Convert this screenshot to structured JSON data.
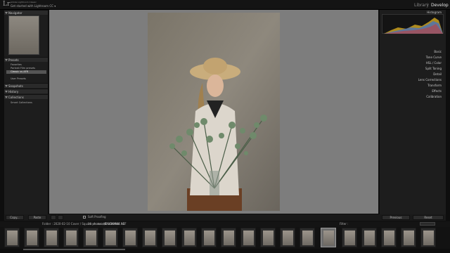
{
  "app": {
    "logo": "Lr",
    "catalog_line1": "Adobe Lightroom Classic",
    "catalog_line2": "Get started with Lightroom CC ▾"
  },
  "modules": {
    "library": "Library",
    "separator": "|",
    "develop": "Develop"
  },
  "left_panel": {
    "navigator": "Navigator",
    "presets": "Presets",
    "preset_items": [
      "Favorites",
      "Portrait Film presets",
      "Classic vs AFR",
      "User Presets"
    ],
    "snapshots": "Snapshots",
    "history": "History",
    "collections": "Collections",
    "collection_items": [
      "Smart Collections"
    ]
  },
  "right_panel": {
    "histogram": "Histogram",
    "sections": [
      "Basic",
      "Tone Curve",
      "HSL / Color",
      "Split Toning",
      "Detail",
      "Lens Corrections",
      "Transform",
      "Effects",
      "Calibration"
    ]
  },
  "toolbar": {
    "copy": "Copy...",
    "paste": "Paste",
    "soft_proofing": "Soft Proofing",
    "previous": "Previous",
    "reset": "Reset"
  },
  "filmstrip": {
    "source": "Folder : 2020-02-10 Cover / Square showcase",
    "count": "16 photos / 1 selected",
    "filename": "/DSC09984.NEF",
    "filter": "Filter :"
  },
  "colors": {
    "selected": "#9a9a9a",
    "panel": "#1d1d1d",
    "canvas": "#7d7d7d"
  }
}
